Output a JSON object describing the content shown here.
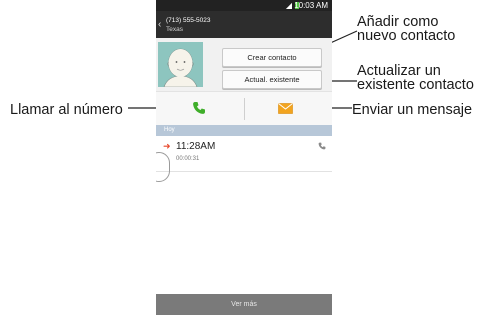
{
  "status_bar": {
    "time": "10:03 AM",
    "signal_icon": "signal-icon",
    "battery_color": "#56c447"
  },
  "title_bar": {
    "back_icon": "back-chevron-icon",
    "phone_number": "(713) 555-5023",
    "location": "Texas"
  },
  "contact": {
    "avatar_icon": "default-avatar-icon",
    "create_button_label": "Crear contacto",
    "update_button_label": "Actual. existente"
  },
  "actions": {
    "call_icon": "phone-icon",
    "call_color": "#3fae2a",
    "message_icon": "envelope-icon",
    "message_color": "#f2a41f"
  },
  "log": {
    "section_label": "Hoy",
    "entries": [
      {
        "direction_icon": "outgoing-arrow-icon",
        "time": "11:28AM",
        "duration": "00:00:31",
        "call_icon": "phone-small-icon"
      }
    ]
  },
  "bottom_bar": {
    "label": "Ver más"
  },
  "callouts": {
    "add_new_contact_line1": "Añadir como",
    "add_new_contact_line2": "nuevo contacto",
    "update_existing_line1": "Actualizar un",
    "update_existing_line2": "existente contacto",
    "send_message": "Enviar un mensaje",
    "call_number": "Llamar al número"
  }
}
